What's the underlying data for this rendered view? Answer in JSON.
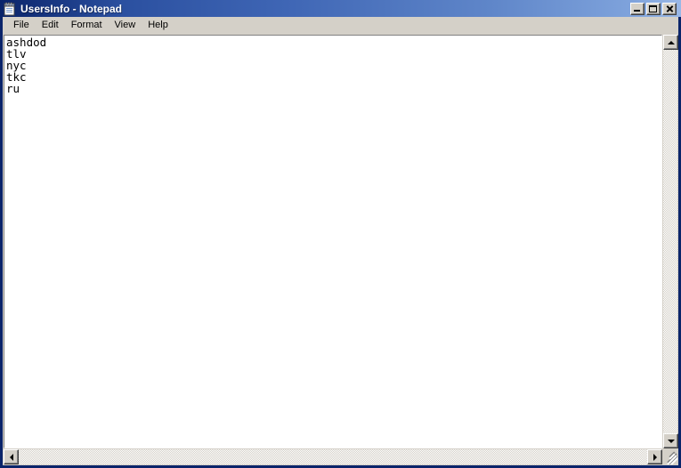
{
  "window": {
    "title": "UsersInfo - Notepad",
    "icon": "notepad-icon",
    "titlebar_gradient_start": "#0a246a",
    "titlebar_gradient_end": "#9ab8e6",
    "frame_color": "#0a246a",
    "chrome_color": "#d4d0c8"
  },
  "window_controls": {
    "minimize_label": "_",
    "maximize_label": "□",
    "close_label": "×"
  },
  "menubar": {
    "items": [
      {
        "label": "File"
      },
      {
        "label": "Edit"
      },
      {
        "label": "Format"
      },
      {
        "label": "View"
      },
      {
        "label": "Help"
      }
    ]
  },
  "editor": {
    "content": "ashdod\ntlv\nnyc\ntkc\nru",
    "lines": [
      "ashdod",
      "tlv",
      "nyc",
      "tkc",
      "ru"
    ],
    "text_color": "#000000",
    "background_color": "#ffffff"
  },
  "scrollbars": {
    "vertical": {
      "up_arrow": "scroll-up-icon",
      "down_arrow": "scroll-down-icon"
    },
    "horizontal": {
      "left_arrow": "scroll-left-icon",
      "right_arrow": "scroll-right-icon"
    }
  }
}
